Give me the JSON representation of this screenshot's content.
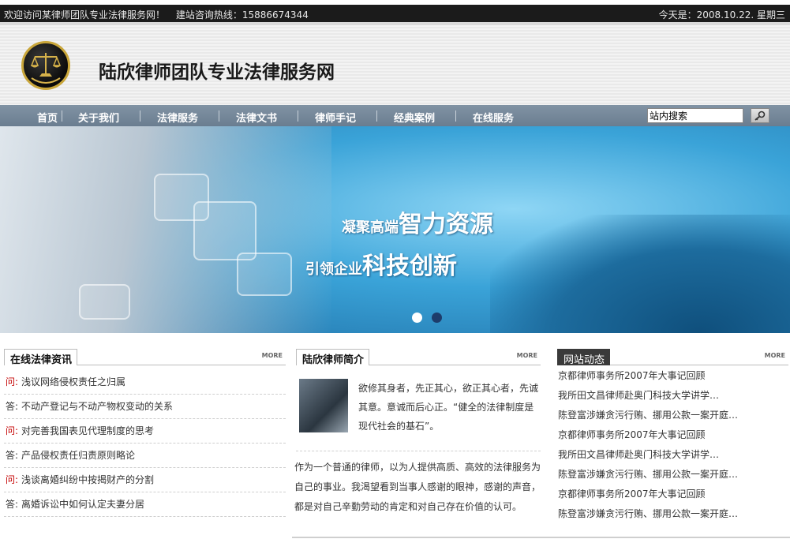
{
  "topbar": {
    "welcome": "欢迎访问某律师团队专业法律服务网！",
    "hotline": "建站咨询热线：15886674344",
    "date": "今天是：2008.10.22. 星期三"
  },
  "header": {
    "site_title": "陆欣律师团队专业法律服务网"
  },
  "nav": {
    "items": [
      "首页",
      "关于我们",
      "法律服务",
      "法律文书",
      "律师手记",
      "经典案例",
      "在线服务"
    ],
    "search_value": "站内搜索"
  },
  "banner": {
    "slogan1_small": "凝聚高端",
    "slogan1_big": "智力资源",
    "slogan2_small": "引领企业",
    "slogan2_big": "科技创新"
  },
  "legal_news": {
    "title": "在线法律资讯",
    "more": "MORE",
    "items": [
      {
        "tag": "问:",
        "text": "浅议网络侵权责任之归属"
      },
      {
        "tag": "答:",
        "text": "不动产登记与不动产物权变动的关系"
      },
      {
        "tag": "问:",
        "text": "对完善我国表见代理制度的思考"
      },
      {
        "tag": "答:",
        "text": "产品侵权责任归责原则略论"
      },
      {
        "tag": "问:",
        "text": "浅谈离婚纠纷中按揭财产的分割"
      },
      {
        "tag": "答:",
        "text": "离婚诉讼中如何认定夫妻分居"
      }
    ]
  },
  "intro": {
    "title": "陆欣律师简介",
    "more": "MORE",
    "short": "欲修其身者，先正其心，欲正其心者，先诚其意。意诚而后心正。“健全的法律制度是 现代社会的基石”。",
    "long": "作为一个普通的律师，以为人提供高质、高效的法律服务为自己的事业。我渴望看到当事人感谢的眼神，感谢的声音，都是对自己辛勤劳动的肯定和对自己存在价值的认可。"
  },
  "site_news": {
    "title": "网站动态",
    "more": "MORE",
    "items": [
      "京都律师事务所2007年大事记回顾",
      "我所田文昌律师赴奥门科技大学讲学…",
      "陈登富涉嫌贪污行贿、挪用公款一案开庭…",
      "京都律师事务所2007年大事记回顾",
      "我所田文昌律师赴奥门科技大学讲学…",
      "陈登富涉嫌贪污行贿、挪用公款一案开庭…",
      "京都律师事务所2007年大事记回顾",
      "陈登富涉嫌贪污行贿、挪用公款一案开庭…"
    ]
  },
  "colors": {
    "topbar_bg": "#1b1b1b",
    "nav_bg": "#7589a0",
    "question_red": "#c40000"
  }
}
